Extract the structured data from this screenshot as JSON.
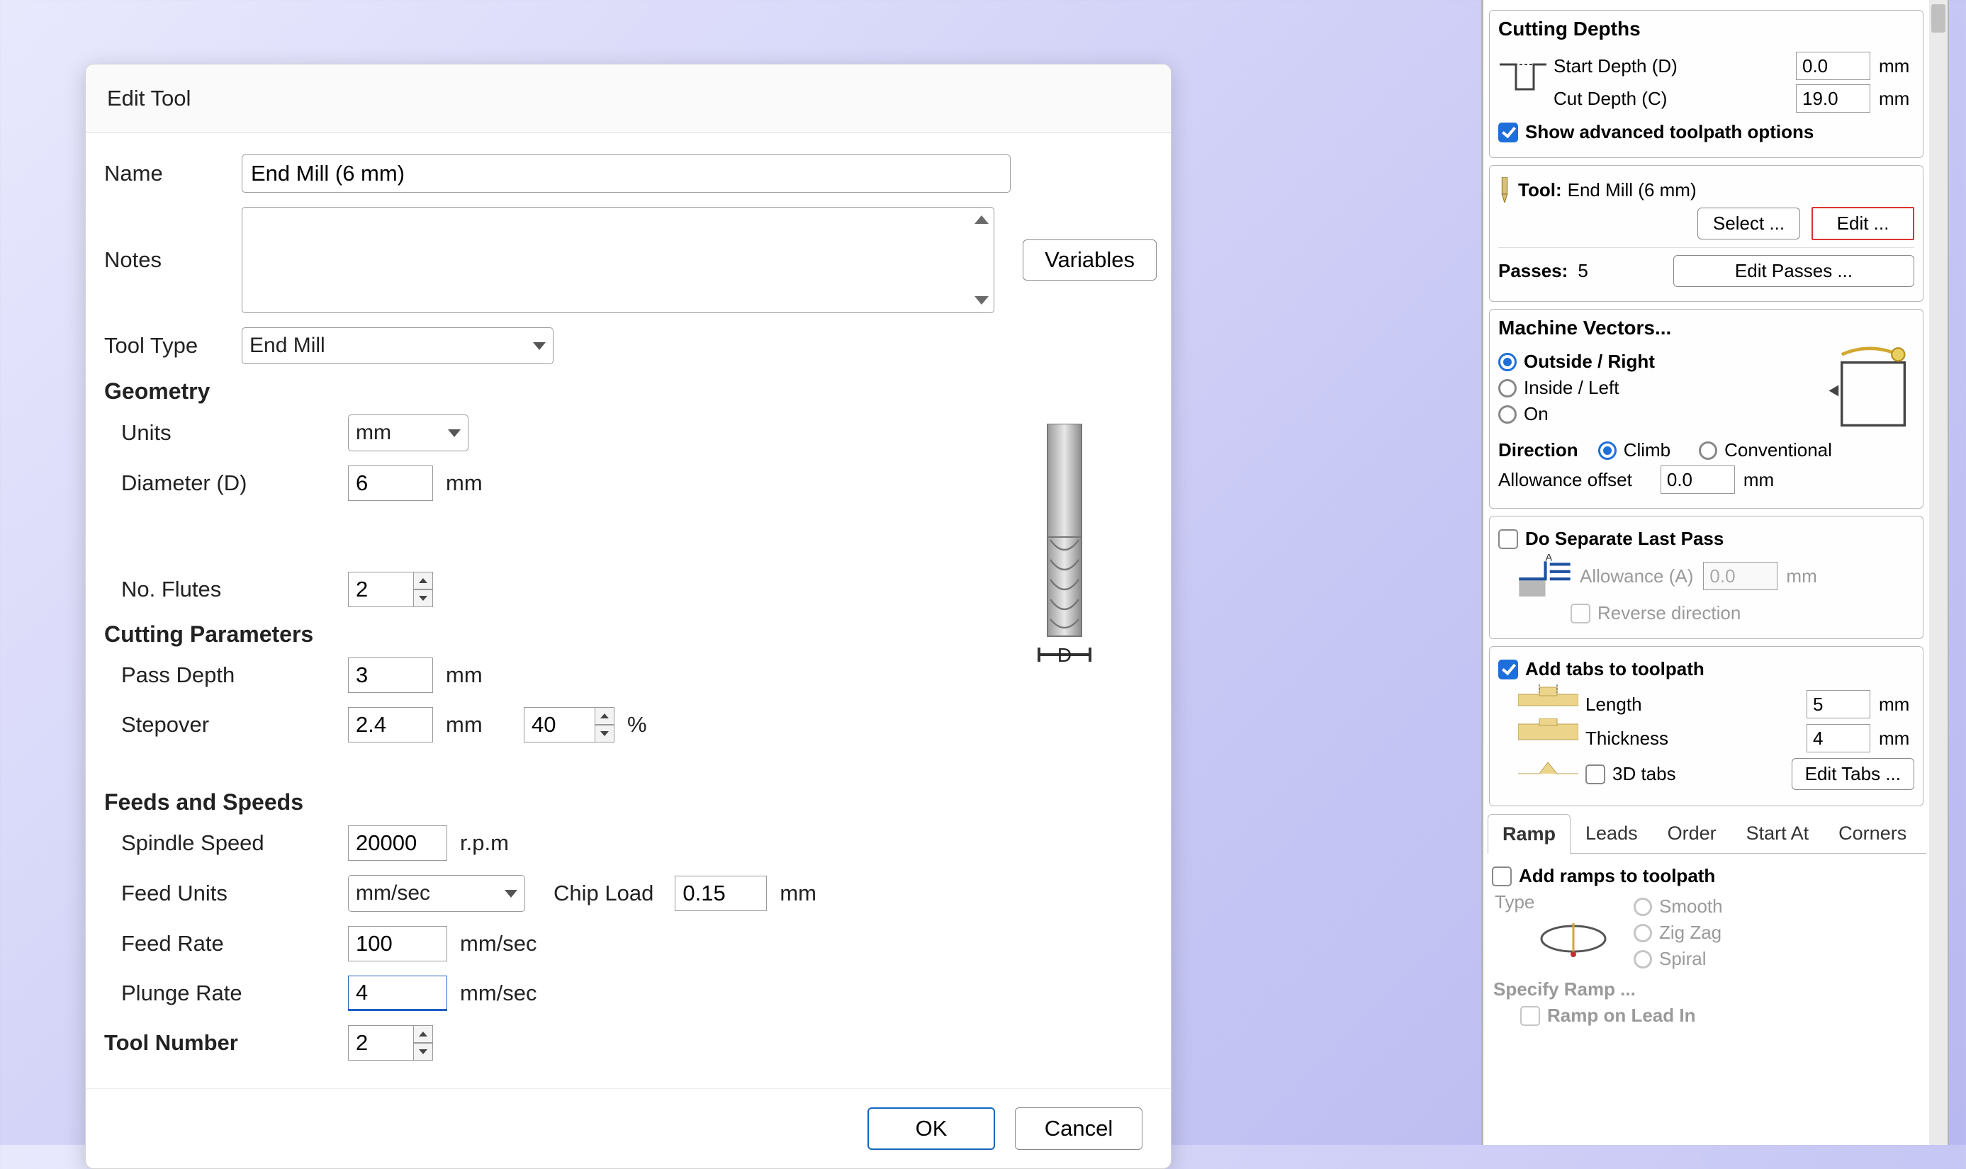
{
  "dialog": {
    "title": "Edit Tool",
    "name_label": "Name",
    "name_value": "End Mill (6 mm)",
    "notes_label": "Notes",
    "notes_value": "",
    "variables_btn": "Variables",
    "tool_type_label": "Tool Type",
    "tool_type_value": "End Mill",
    "geometry_head": "Geometry",
    "units_label": "Units",
    "units_value": "mm",
    "diameter_label": "Diameter (D)",
    "diameter_value": "6",
    "diameter_unit": "mm",
    "flutes_label": "No. Flutes",
    "flutes_value": "2",
    "cut_params_head": "Cutting Parameters",
    "pass_depth_label": "Pass Depth",
    "pass_depth_value": "3",
    "pass_depth_unit": "mm",
    "stepover_label": "Stepover",
    "stepover_value": "2.4",
    "stepover_unit": "mm",
    "stepover_pct": "40",
    "pct_unit": "%",
    "feeds_head": "Feeds and Speeds",
    "spindle_label": "Spindle Speed",
    "spindle_value": "20000",
    "spindle_unit": "r.p.m",
    "feed_units_label": "Feed Units",
    "feed_units_value": "mm/sec",
    "chip_load_label": "Chip Load",
    "chip_load_value": "0.15",
    "chip_load_unit": "mm",
    "feed_rate_label": "Feed Rate",
    "feed_rate_value": "100",
    "feed_rate_unit": "mm/sec",
    "plunge_rate_label": "Plunge Rate",
    "plunge_rate_value": "4",
    "plunge_rate_unit": "mm/sec",
    "tool_number_label": "Tool Number",
    "tool_number_value": "2",
    "tool_diagram_label": "D",
    "ok_btn": "OK",
    "cancel_btn": "Cancel"
  },
  "panel": {
    "cd_title": "Cutting Depths",
    "start_depth_label": "Start Depth (D)",
    "start_depth_value": "0.0",
    "start_depth_unit": "mm",
    "cut_depth_label": "Cut Depth (C)",
    "cut_depth_value": "19.0",
    "cut_depth_unit": "mm",
    "show_advanced_label": "Show advanced toolpath options",
    "tool_prefix": "Tool:",
    "tool_name": "End Mill (6 mm)",
    "select_btn": "Select ...",
    "edit_btn": "Edit ...",
    "passes_prefix": "Passes:",
    "passes_value": "5",
    "edit_passes_btn": "Edit Passes ...",
    "mv_title": "Machine Vectors...",
    "mv_outside": "Outside / Right",
    "mv_inside": "Inside / Left",
    "mv_on": "On",
    "direction_label": "Direction",
    "dir_climb": "Climb",
    "dir_conv": "Conventional",
    "allowance_label": "Allowance offset",
    "allowance_value": "0.0",
    "allowance_unit": "mm",
    "dlp_label": "Do Separate Last Pass",
    "dlp_allow_label": "Allowance (A)",
    "dlp_allow_value": "0.0",
    "dlp_allow_unit": "mm",
    "dlp_reverse_label": "Reverse direction",
    "tabs_label": "Add tabs to toolpath",
    "tabs_length_label": "Length",
    "tabs_length_value": "5",
    "tabs_length_unit": "mm",
    "tabs_thick_label": "Thickness",
    "tabs_thick_value": "4",
    "tabs_thick_unit": "mm",
    "tabs_3d_label": "3D tabs",
    "edit_tabs_btn": "Edit Tabs ...",
    "tab_strip": {
      "ramp": "Ramp",
      "leads": "Leads",
      "order": "Order",
      "start": "Start At",
      "corners": "Corners"
    },
    "ramp_add_label": "Add ramps to toolpath",
    "ramp_type_label": "Type",
    "ramp_smooth": "Smooth",
    "ramp_zigzag": "Zig Zag",
    "ramp_spiral": "Spiral",
    "ramp_specify": "Specify Ramp ...",
    "ramp_leadin": "Ramp on Lead In"
  }
}
